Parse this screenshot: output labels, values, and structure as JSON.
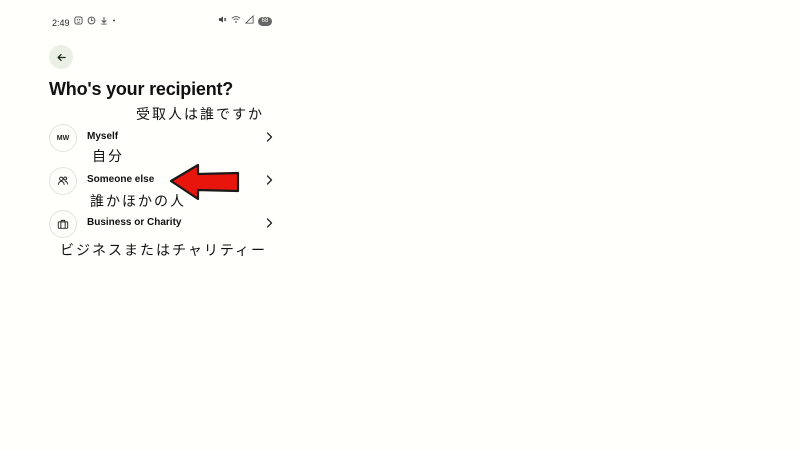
{
  "status_bar": {
    "time": "2:49",
    "left_icons": [
      "face-id-icon",
      "sync-icon",
      "download-icon",
      "dot-icon"
    ],
    "battery_level": "68",
    "right_icons": [
      "mute-icon",
      "wifi-icon",
      "signal-icon"
    ]
  },
  "header": {
    "title": "Who's your recipient?"
  },
  "options": [
    {
      "id": "myself",
      "avatar_text": "MW",
      "label": "Myself"
    },
    {
      "id": "someone-else",
      "icon": "people-icon",
      "label": "Someone else"
    },
    {
      "id": "business",
      "icon": "briefcase-icon",
      "label": "Business or Charity"
    }
  ],
  "annotations": {
    "title_note": "受取人は誰ですか",
    "myself_note": "自分",
    "someone_note": "誰かほかの人",
    "business_note": "ビジネスまたはチャリティー"
  },
  "colors": {
    "background": "#fffffb",
    "back_button_bg": "#eaf0e6",
    "arrow_red": "#e8150d"
  }
}
